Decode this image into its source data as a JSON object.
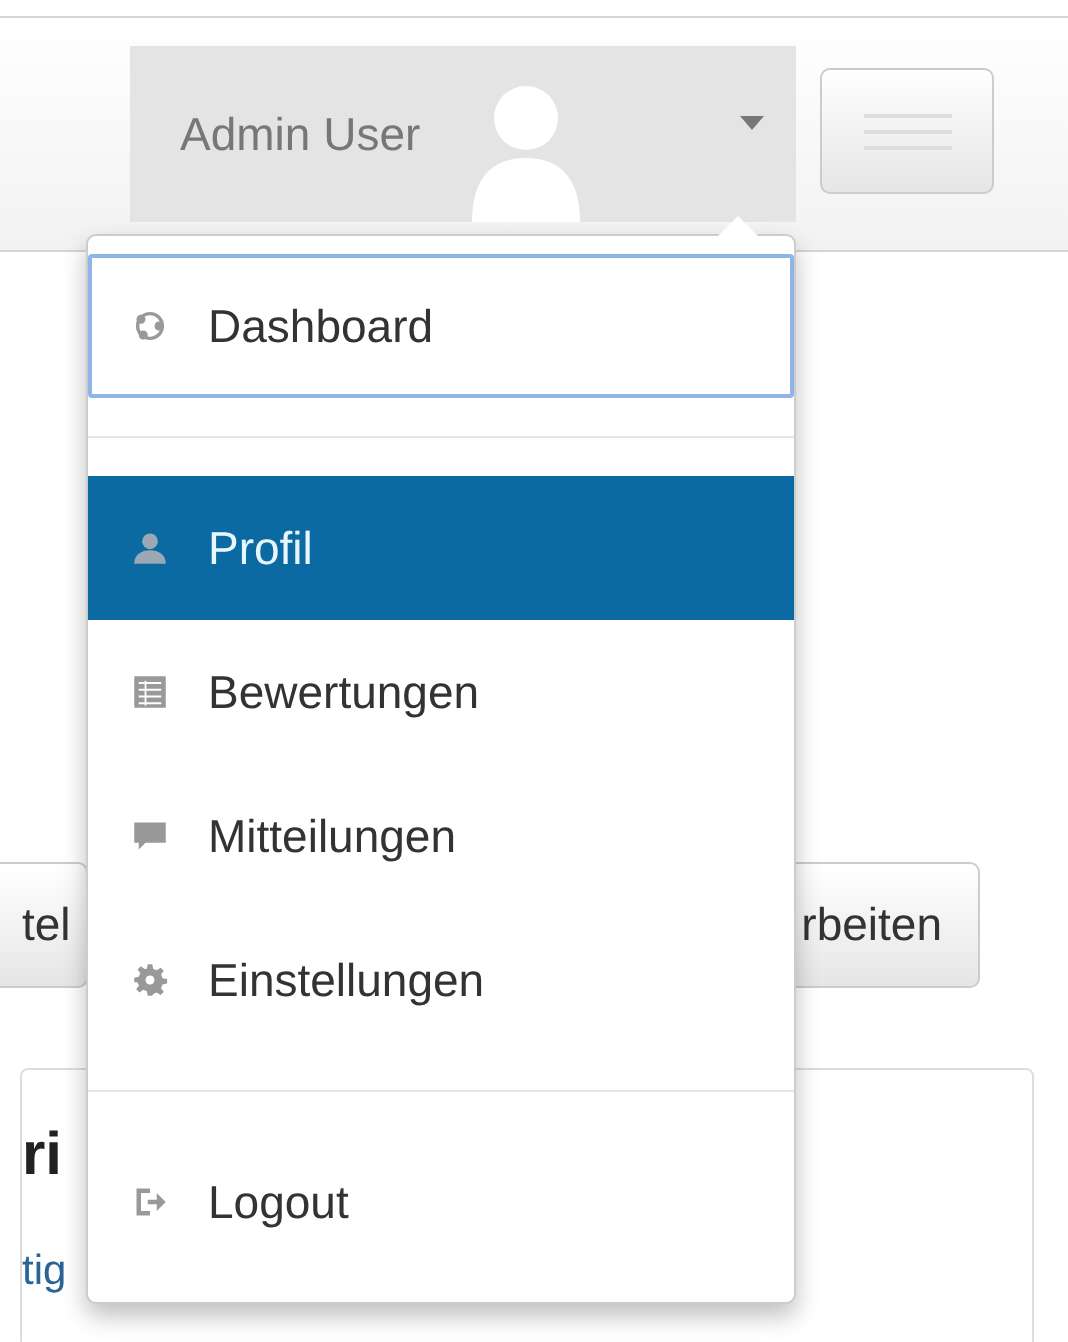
{
  "navbar": {
    "user_button": {
      "label": "Admin User",
      "expanded": true
    }
  },
  "background": {
    "left_button": "tel",
    "right_button": "rbeiten",
    "card_heading": "ri",
    "card_link": "tig"
  },
  "menu": [
    {
      "kind": "item",
      "label": "Dashboard",
      "selected": false,
      "focused": true
    },
    {
      "kind": "divider"
    },
    {
      "kind": "item",
      "label": "Profil",
      "selected": true,
      "focused": false
    },
    {
      "kind": "item",
      "label": "Bewertungen",
      "selected": false,
      "focused": false
    },
    {
      "kind": "item",
      "label": "Mitteilungen",
      "selected": false,
      "focused": false
    },
    {
      "kind": "item",
      "label": "Einstellungen",
      "selected": false,
      "focused": false
    },
    {
      "kind": "divider"
    },
    {
      "kind": "item",
      "label": "Logout",
      "selected": false,
      "focused": false
    }
  ]
}
